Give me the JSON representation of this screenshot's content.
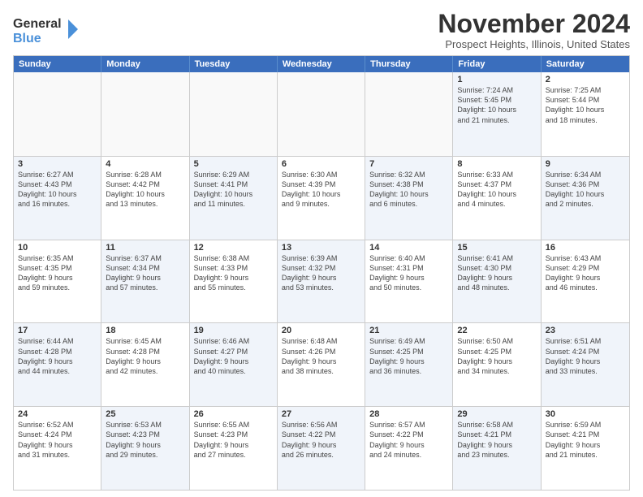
{
  "logo": {
    "line1": "General",
    "line2": "Blue"
  },
  "title": "November 2024",
  "location": "Prospect Heights, Illinois, United States",
  "headers": [
    "Sunday",
    "Monday",
    "Tuesday",
    "Wednesday",
    "Thursday",
    "Friday",
    "Saturday"
  ],
  "rows": [
    [
      {
        "day": "",
        "info": "",
        "empty": true
      },
      {
        "day": "",
        "info": "",
        "empty": true
      },
      {
        "day": "",
        "info": "",
        "empty": true
      },
      {
        "day": "",
        "info": "",
        "empty": true
      },
      {
        "day": "",
        "info": "",
        "empty": true
      },
      {
        "day": "1",
        "info": "Sunrise: 7:24 AM\nSunset: 5:45 PM\nDaylight: 10 hours\nand 21 minutes.",
        "alt": true
      },
      {
        "day": "2",
        "info": "Sunrise: 7:25 AM\nSunset: 5:44 PM\nDaylight: 10 hours\nand 18 minutes.",
        "alt": false
      }
    ],
    [
      {
        "day": "3",
        "info": "Sunrise: 6:27 AM\nSunset: 4:43 PM\nDaylight: 10 hours\nand 16 minutes.",
        "alt": true
      },
      {
        "day": "4",
        "info": "Sunrise: 6:28 AM\nSunset: 4:42 PM\nDaylight: 10 hours\nand 13 minutes.",
        "alt": false
      },
      {
        "day": "5",
        "info": "Sunrise: 6:29 AM\nSunset: 4:41 PM\nDaylight: 10 hours\nand 11 minutes.",
        "alt": true
      },
      {
        "day": "6",
        "info": "Sunrise: 6:30 AM\nSunset: 4:39 PM\nDaylight: 10 hours\nand 9 minutes.",
        "alt": false
      },
      {
        "day": "7",
        "info": "Sunrise: 6:32 AM\nSunset: 4:38 PM\nDaylight: 10 hours\nand 6 minutes.",
        "alt": true
      },
      {
        "day": "8",
        "info": "Sunrise: 6:33 AM\nSunset: 4:37 PM\nDaylight: 10 hours\nand 4 minutes.",
        "alt": false
      },
      {
        "day": "9",
        "info": "Sunrise: 6:34 AM\nSunset: 4:36 PM\nDaylight: 10 hours\nand 2 minutes.",
        "alt": true
      }
    ],
    [
      {
        "day": "10",
        "info": "Sunrise: 6:35 AM\nSunset: 4:35 PM\nDaylight: 9 hours\nand 59 minutes.",
        "alt": false
      },
      {
        "day": "11",
        "info": "Sunrise: 6:37 AM\nSunset: 4:34 PM\nDaylight: 9 hours\nand 57 minutes.",
        "alt": true
      },
      {
        "day": "12",
        "info": "Sunrise: 6:38 AM\nSunset: 4:33 PM\nDaylight: 9 hours\nand 55 minutes.",
        "alt": false
      },
      {
        "day": "13",
        "info": "Sunrise: 6:39 AM\nSunset: 4:32 PM\nDaylight: 9 hours\nand 53 minutes.",
        "alt": true
      },
      {
        "day": "14",
        "info": "Sunrise: 6:40 AM\nSunset: 4:31 PM\nDaylight: 9 hours\nand 50 minutes.",
        "alt": false
      },
      {
        "day": "15",
        "info": "Sunrise: 6:41 AM\nSunset: 4:30 PM\nDaylight: 9 hours\nand 48 minutes.",
        "alt": true
      },
      {
        "day": "16",
        "info": "Sunrise: 6:43 AM\nSunset: 4:29 PM\nDaylight: 9 hours\nand 46 minutes.",
        "alt": false
      }
    ],
    [
      {
        "day": "17",
        "info": "Sunrise: 6:44 AM\nSunset: 4:28 PM\nDaylight: 9 hours\nand 44 minutes.",
        "alt": true
      },
      {
        "day": "18",
        "info": "Sunrise: 6:45 AM\nSunset: 4:28 PM\nDaylight: 9 hours\nand 42 minutes.",
        "alt": false
      },
      {
        "day": "19",
        "info": "Sunrise: 6:46 AM\nSunset: 4:27 PM\nDaylight: 9 hours\nand 40 minutes.",
        "alt": true
      },
      {
        "day": "20",
        "info": "Sunrise: 6:48 AM\nSunset: 4:26 PM\nDaylight: 9 hours\nand 38 minutes.",
        "alt": false
      },
      {
        "day": "21",
        "info": "Sunrise: 6:49 AM\nSunset: 4:25 PM\nDaylight: 9 hours\nand 36 minutes.",
        "alt": true
      },
      {
        "day": "22",
        "info": "Sunrise: 6:50 AM\nSunset: 4:25 PM\nDaylight: 9 hours\nand 34 minutes.",
        "alt": false
      },
      {
        "day": "23",
        "info": "Sunrise: 6:51 AM\nSunset: 4:24 PM\nDaylight: 9 hours\nand 33 minutes.",
        "alt": true
      }
    ],
    [
      {
        "day": "24",
        "info": "Sunrise: 6:52 AM\nSunset: 4:24 PM\nDaylight: 9 hours\nand 31 minutes.",
        "alt": false
      },
      {
        "day": "25",
        "info": "Sunrise: 6:53 AM\nSunset: 4:23 PM\nDaylight: 9 hours\nand 29 minutes.",
        "alt": true
      },
      {
        "day": "26",
        "info": "Sunrise: 6:55 AM\nSunset: 4:23 PM\nDaylight: 9 hours\nand 27 minutes.",
        "alt": false
      },
      {
        "day": "27",
        "info": "Sunrise: 6:56 AM\nSunset: 4:22 PM\nDaylight: 9 hours\nand 26 minutes.",
        "alt": true
      },
      {
        "day": "28",
        "info": "Sunrise: 6:57 AM\nSunset: 4:22 PM\nDaylight: 9 hours\nand 24 minutes.",
        "alt": false
      },
      {
        "day": "29",
        "info": "Sunrise: 6:58 AM\nSunset: 4:21 PM\nDaylight: 9 hours\nand 23 minutes.",
        "alt": true
      },
      {
        "day": "30",
        "info": "Sunrise: 6:59 AM\nSunset: 4:21 PM\nDaylight: 9 hours\nand 21 minutes.",
        "alt": false
      }
    ]
  ]
}
